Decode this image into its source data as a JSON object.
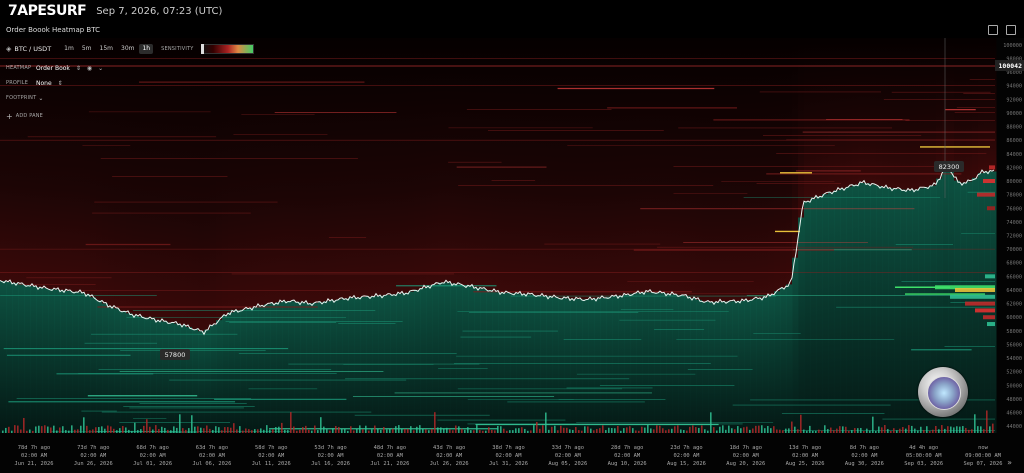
{
  "app": {
    "logo": "7APESURF",
    "datetime": "Sep 7, 2026, 07:23 (UTC)"
  },
  "chart_header": {
    "title": "Order Boook Heatmap BTC"
  },
  "toolbar": {
    "pair": "BTC / USDT",
    "timeframes": [
      "1m",
      "5m",
      "15m",
      "30m",
      "1h"
    ],
    "active_timeframe": "1h",
    "sensitivity_label": "SENSITIVITY"
  },
  "panel": {
    "heatmap_label": "HEATMAP",
    "heatmap_value": "Order Book",
    "profile_label": "PROFILE",
    "profile_value": "None",
    "footprint_label": "FOOTPRINT",
    "add_pane": "ADD PANE"
  },
  "price_axis": {
    "ticks": [
      "100000",
      "98000",
      "96000",
      "94000",
      "92000",
      "90000",
      "88000",
      "86000",
      "84000",
      "82000",
      "80000",
      "78000",
      "76000",
      "74000",
      "72000",
      "70000",
      "68000",
      "66000",
      "64000",
      "62000",
      "60000",
      "58000",
      "56000",
      "54000",
      "52000",
      "50000",
      "48000",
      "46000",
      "44000"
    ],
    "current_price": "100042"
  },
  "time_axis": {
    "labels": [
      {
        "ago": "78d 7h ago",
        "time": "02:00 AM",
        "date": "Jun 21, 2026"
      },
      {
        "ago": "73d 7h ago",
        "time": "02:00 AM",
        "date": "Jun 26, 2026"
      },
      {
        "ago": "68d 7h ago",
        "time": "02:00 AM",
        "date": "Jul 01, 2026"
      },
      {
        "ago": "63d 7h ago",
        "time": "02:00 AM",
        "date": "Jul 06, 2026"
      },
      {
        "ago": "58d 7h ago",
        "time": "02:00 AM",
        "date": "Jul 11, 2026"
      },
      {
        "ago": "53d 7h ago",
        "time": "02:00 AM",
        "date": "Jul 16, 2026"
      },
      {
        "ago": "48d 7h ago",
        "time": "02:00 AM",
        "date": "Jul 21, 2026"
      },
      {
        "ago": "43d 7h ago",
        "time": "02:00 AM",
        "date": "Jul 26, 2026"
      },
      {
        "ago": "38d 7h ago",
        "time": "02:00 AM",
        "date": "Jul 31, 2026"
      },
      {
        "ago": "33d 7h ago",
        "time": "02:00 AM",
        "date": "Aug 05, 2026"
      },
      {
        "ago": "28d 7h ago",
        "time": "02:00 AM",
        "date": "Aug 10, 2026"
      },
      {
        "ago": "23d 7h ago",
        "time": "02:00 AM",
        "date": "Aug 15, 2026"
      },
      {
        "ago": "18d 7h ago",
        "time": "02:00 AM",
        "date": "Aug 20, 2026"
      },
      {
        "ago": "13d 7h ago",
        "time": "02:00 AM",
        "date": "Aug 25, 2026"
      },
      {
        "ago": "8d 7h ago",
        "time": "02:00 AM",
        "date": "Aug 30, 2026"
      },
      {
        "ago": "4d 4h ago",
        "time": "05:00:00 AM",
        "date": "Sep 03, 2026"
      },
      {
        "ago": "now",
        "time": "09:00:00 AM",
        "date": "Sep 07, 2026"
      }
    ]
  },
  "annotations": {
    "high": "82300",
    "low": "57800"
  },
  "nav": {
    "scroll_right": "»"
  },
  "colors": {
    "bid": "#1fbf8f",
    "ask": "#c0282a",
    "price_line": "#e8f4f0",
    "wall_yellow": "#e8c23a",
    "wall_green": "#3ee06a"
  },
  "chart_data": {
    "type": "heatmap",
    "title": "Order Boook Heatmap BTC",
    "x_start": "Jun 21, 2026",
    "x_end": "Sep 07, 2026",
    "ylim": [
      43000,
      101000
    ],
    "price_path": [
      [
        "Jun 19",
        64800
      ],
      [
        "Jun 21",
        64200
      ],
      [
        "Jun 24",
        63600
      ],
      [
        "Jun 26",
        61800
      ],
      [
        "Jun 28",
        60400
      ],
      [
        "Jun 30",
        59600
      ],
      [
        "Jul 02",
        59000
      ],
      [
        "Jul 04",
        57800
      ],
      [
        "Jul 06",
        60600
      ],
      [
        "Jul 09",
        61800
      ],
      [
        "Jul 11",
        62400
      ],
      [
        "Jul 13",
        62000
      ],
      [
        "Jul 16",
        62800
      ],
      [
        "Jul 19",
        63200
      ],
      [
        "Jul 21",
        63600
      ],
      [
        "Jul 24",
        65200
      ],
      [
        "Jul 26",
        64600
      ],
      [
        "Jul 29",
        63600
      ],
      [
        "Jul 31",
        63400
      ],
      [
        "Aug 03",
        62800
      ],
      [
        "Aug 05",
        62600
      ],
      [
        "Aug 08",
        63200
      ],
      [
        "Aug 10",
        63800
      ],
      [
        "Aug 13",
        63200
      ],
      [
        "Aug 15",
        62200
      ],
      [
        "Aug 18",
        62400
      ],
      [
        "Aug 20",
        63000
      ],
      [
        "Aug 22",
        65000
      ],
      [
        "Aug 23",
        76800
      ],
      [
        "Aug 25",
        78200
      ],
      [
        "Aug 28",
        79800
      ],
      [
        "Aug 30",
        79000
      ],
      [
        "Sep 01",
        78600
      ],
      [
        "Sep 03",
        79400
      ],
      [
        "Sep 04",
        82300
      ],
      [
        "Sep 05",
        79600
      ],
      [
        "Sep 06",
        80000
      ],
      [
        "Sep 07",
        81400
      ]
    ],
    "ylabel": "",
    "grid": false
  }
}
